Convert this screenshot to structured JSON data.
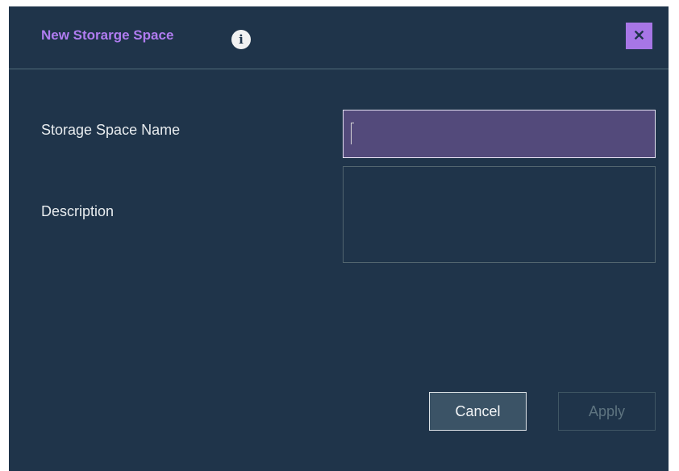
{
  "dialog": {
    "title": "New Storarge Space",
    "info_icon": "info-icon",
    "info_glyph": "i",
    "close_icon": "close-icon",
    "close_glyph": "✕"
  },
  "form": {
    "name_label": "Storage Space Name",
    "name_value": "",
    "description_label": "Description",
    "description_value": ""
  },
  "buttons": {
    "cancel_label": "Cancel",
    "apply_label": "Apply"
  },
  "colors": {
    "dialog_background": "#1f344a",
    "title_accent": "#b07cf0",
    "close_button": "#a776e6",
    "focused_input": "#534a7b"
  }
}
